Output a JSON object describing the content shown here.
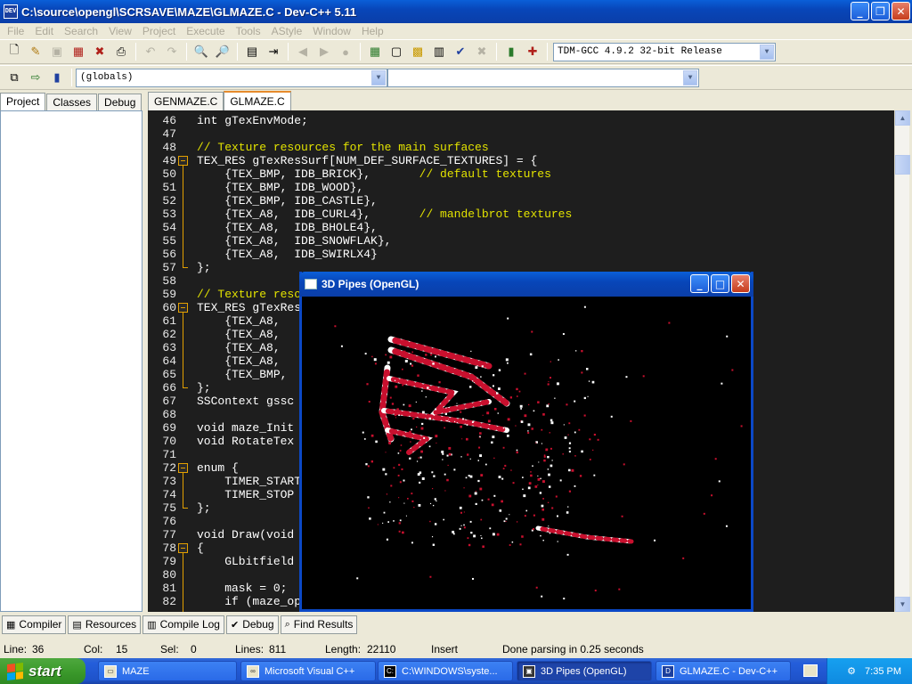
{
  "window": {
    "title": "C:\\source\\opengl\\SCRSAVE\\MAZE\\GLMAZE.C - Dev-C++ 5.11",
    "icon_text": "DEV"
  },
  "menu": [
    "File",
    "Edit",
    "Search",
    "View",
    "Project",
    "Execute",
    "Tools",
    "AStyle",
    "Window",
    "Help"
  ],
  "toolbar": {
    "compiler": "TDM-GCC 4.9.2 32-bit Release",
    "scope": "(globals)",
    "function": ""
  },
  "left_tabs": [
    "Project",
    "Classes",
    "Debug"
  ],
  "editor_tabs": [
    "GENMAZE.C",
    "GLMAZE.C"
  ],
  "editor": {
    "lines": [
      {
        "n": "46",
        "t": "int gTexEnvMode;"
      },
      {
        "n": "47",
        "t": ""
      },
      {
        "n": "48",
        "t": "",
        "c": "// Texture resources for the main surfaces"
      },
      {
        "n": "49",
        "t": "TEX_RES gTexResSurf[NUM_DEF_SURFACE_TEXTURES] = {",
        "fold": true
      },
      {
        "n": "50",
        "t": "    {TEX_BMP, IDB_BRICK},       ",
        "c": "// default textures"
      },
      {
        "n": "51",
        "t": "    {TEX_BMP, IDB_WOOD},"
      },
      {
        "n": "52",
        "t": "    {TEX_BMP, IDB_CASTLE},"
      },
      {
        "n": "53",
        "t": "    {TEX_A8,  IDB_CURL4},       ",
        "c": "// mandelbrot textures"
      },
      {
        "n": "54",
        "t": "    {TEX_A8,  IDB_BHOLE4},"
      },
      {
        "n": "55",
        "t": "    {TEX_A8,  IDB_SNOWFLAK},"
      },
      {
        "n": "56",
        "t": "    {TEX_A8,  IDB_SWIRLX4}"
      },
      {
        "n": "57",
        "t": "};"
      },
      {
        "n": "58",
        "t": ""
      },
      {
        "n": "59",
        "t": "",
        "c": "// Texture reso"
      },
      {
        "n": "60",
        "t": "TEX_RES gTexRes",
        "fold": true
      },
      {
        "n": "61",
        "t": "    {TEX_A8,"
      },
      {
        "n": "62",
        "t": "    {TEX_A8,"
      },
      {
        "n": "63",
        "t": "    {TEX_A8,"
      },
      {
        "n": "64",
        "t": "    {TEX_A8,"
      },
      {
        "n": "65",
        "t": "    {TEX_BMP,"
      },
      {
        "n": "66",
        "t": "};"
      },
      {
        "n": "67",
        "t": "SSContext gssc"
      },
      {
        "n": "68",
        "t": ""
      },
      {
        "n": "69",
        "t": "void maze_Init"
      },
      {
        "n": "70",
        "t": "void RotateTex"
      },
      {
        "n": "71",
        "t": ""
      },
      {
        "n": "72",
        "t": "enum {",
        "fold": true
      },
      {
        "n": "73",
        "t": "    TIMER_START"
      },
      {
        "n": "74",
        "t": "    TIMER_STOP"
      },
      {
        "n": "75",
        "t": "};"
      },
      {
        "n": "76",
        "t": ""
      },
      {
        "n": "77",
        "t": "void Draw(void"
      },
      {
        "n": "78",
        "t": "{",
        "fold": true
      },
      {
        "n": "79",
        "t": "    GLbitfield"
      },
      {
        "n": "80",
        "t": ""
      },
      {
        "n": "81",
        "t": "    mask = 0;"
      },
      {
        "n": "82",
        "t": "    if (maze_op"
      }
    ]
  },
  "bottom_tabs": [
    {
      "label": "Compiler",
      "icon": "grid-icon"
    },
    {
      "label": "Resources",
      "icon": "resources-icon"
    },
    {
      "label": "Compile Log",
      "icon": "log-icon"
    },
    {
      "label": "Debug",
      "icon": "check-icon"
    },
    {
      "label": "Find Results",
      "icon": "find-icon"
    }
  ],
  "status": {
    "line_label": "Line:",
    "line": "36",
    "col_label": "Col:",
    "col": "15",
    "sel_label": "Sel:",
    "sel": "0",
    "lines_label": "Lines:",
    "lines": "811",
    "length_label": "Length:",
    "length": "22110",
    "mode": "Insert",
    "message": "Done parsing in 0.25 seconds"
  },
  "gl_window": {
    "title": "3D Pipes (OpenGL)"
  },
  "taskbar": {
    "start": "start",
    "tasks": [
      {
        "label": "MAZE",
        "icon": "folder-icon"
      },
      {
        "label": "Microsoft Visual C++",
        "icon": "vc-icon"
      },
      {
        "label": "C:\\WINDOWS\\syste...",
        "icon": "cmd-icon"
      },
      {
        "label": "3D Pipes (OpenGL)",
        "icon": "gl-icon"
      },
      {
        "label": "GLMAZE.C - Dev-C++",
        "icon": "devcpp-icon"
      }
    ],
    "clock": "7:35 PM"
  },
  "colors": {
    "editor_bg": "#1e1e1e",
    "comment": "#e3e300",
    "fold": "#e3a000",
    "xp_blue": "#0a5fd8",
    "pipe_red": "#c8102e",
    "pipe_white": "#ffffff"
  }
}
